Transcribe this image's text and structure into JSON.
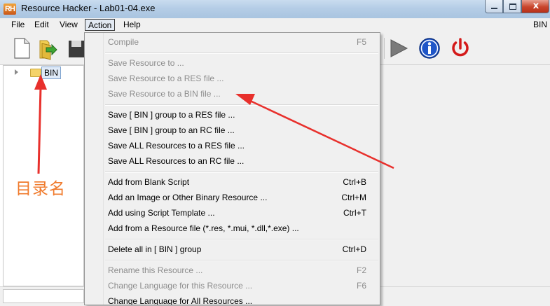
{
  "window": {
    "title": "Resource Hacker - Lab01-04.exe",
    "logo_text": "RH",
    "close_symbol": "x",
    "colors": {
      "titlebar": "#b5cde6",
      "close": "#c8452c"
    }
  },
  "menubar": {
    "items": [
      {
        "label": "File"
      },
      {
        "label": "Edit"
      },
      {
        "label": "View"
      },
      {
        "label": "Action"
      },
      {
        "label": "Help"
      }
    ],
    "right_text": "BIN"
  },
  "toolbar": {
    "icons": [
      "new-file-icon",
      "open-folder-icon",
      "save-icon",
      "play-icon",
      "info-icon",
      "power-icon"
    ]
  },
  "tree": {
    "root": {
      "label": "BIN",
      "icon": "folder-icon",
      "expanded": false
    }
  },
  "action_menu": {
    "groups": [
      [
        {
          "label": "Compile",
          "shortcut": "F5",
          "enabled": false
        }
      ],
      [
        {
          "label": "Save Resource to ...",
          "shortcut": "",
          "enabled": false
        },
        {
          "label": "Save Resource to a RES file ...",
          "shortcut": "",
          "enabled": false
        },
        {
          "label": "Save Resource to a BIN file ...",
          "shortcut": "",
          "enabled": false
        }
      ],
      [
        {
          "label": "Save [ BIN ] group to a RES file ...",
          "shortcut": "",
          "enabled": true
        },
        {
          "label": "Save [ BIN ] group to an RC file ...",
          "shortcut": "",
          "enabled": true
        },
        {
          "label": "Save ALL Resources to a RES file ...",
          "shortcut": "",
          "enabled": true
        },
        {
          "label": "Save ALL Resources to an RC file ...",
          "shortcut": "",
          "enabled": true
        }
      ],
      [
        {
          "label": "Add from Blank Script",
          "shortcut": "Ctrl+B",
          "enabled": true
        },
        {
          "label": "Add an Image or Other Binary Resource ...",
          "shortcut": "Ctrl+M",
          "enabled": true
        },
        {
          "label": "Add using Script Template ...",
          "shortcut": "Ctrl+T",
          "enabled": true
        },
        {
          "label": "Add from a Resource file (*.res, *.mui, *.dll,*.exe) ...",
          "shortcut": "",
          "enabled": true
        }
      ],
      [
        {
          "label": "Delete all in [ BIN ] group",
          "shortcut": "Ctrl+D",
          "enabled": true
        }
      ],
      [
        {
          "label": "Rename this Resource ...",
          "shortcut": "F2",
          "enabled": false
        },
        {
          "label": "Change Language for this Resource ...",
          "shortcut": "F6",
          "enabled": false
        },
        {
          "label": "Change Language for All Resources ...",
          "shortcut": "",
          "enabled": true
        }
      ]
    ]
  },
  "annotation": {
    "text": "目录名",
    "color": "#f07b2d",
    "arrow_color": "#e8302c"
  }
}
